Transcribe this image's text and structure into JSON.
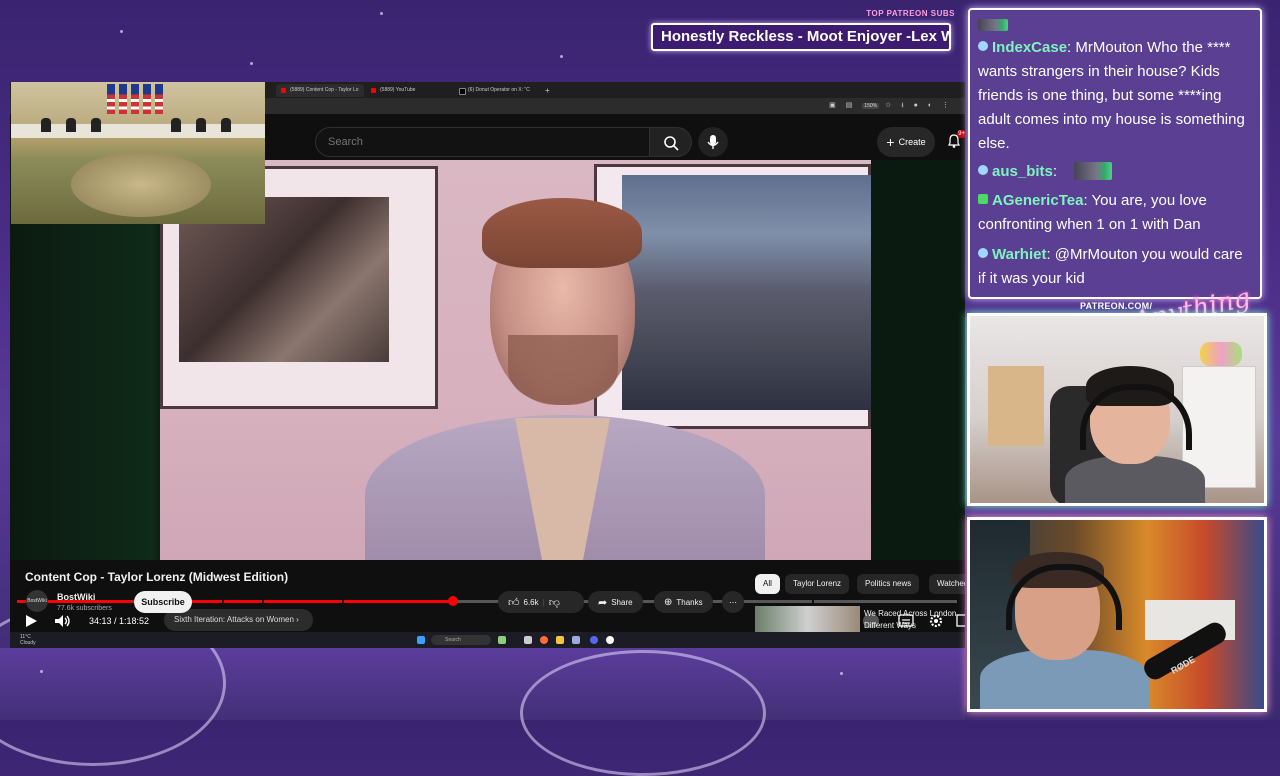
{
  "overlay": {
    "patreon_heading": "TOP PATREON SUBS",
    "patreon_ticker": "Honestly Reckless - Moot Enjoyer -Lex Wi",
    "patreon_url": "PATREON.COM/",
    "anything_else_logo": "AnythingElse"
  },
  "browser": {
    "tabs": [
      {
        "label": "(5889) Content Cop - Taylor Lo"
      },
      {
        "label": "(5889) YouTube"
      },
      {
        "label": "(6) Donut Operator on X: \"C"
      }
    ],
    "zoom": "150%"
  },
  "youtube": {
    "search_placeholder": "Search",
    "create_label": "Create",
    "notification_count": "9+",
    "player": {
      "current_time": "34:13",
      "duration": "1:18:52",
      "time_display": "34:13 / 1:18:52",
      "progress_fraction": 0.464,
      "chapter_label": "Sixth Iteration: Attacks on Women"
    },
    "video_title": "Content Cop - Taylor Lorenz (Midwest Edition)",
    "channel": {
      "name": "BostWiki",
      "subscribers": "77.6k subscribers",
      "avatar_text": "BostWiki"
    },
    "subscribe_label": "Subscribe",
    "like_count": "6.6k",
    "share_label": "Share",
    "thanks_label": "Thanks",
    "chips": [
      "All",
      "Taylor Lorenz",
      "Politics news",
      "Watched"
    ],
    "recommendation": {
      "title": "We Raced Across London Different Ways"
    }
  },
  "taskbar": {
    "weather_temp": "11°C",
    "weather_desc": "Cloudy",
    "search_label": "Search"
  },
  "chat": {
    "messages": [
      {
        "user": "IndexCase",
        "user_color": "#7ff3c0",
        "text": "MrMouton Who the **** wants strangers in their house? Kids friends is one thing, but some ****ing adult comes into my house is something else."
      },
      {
        "user": "aus_bits",
        "user_color": "#7ff3c0",
        "text": ""
      },
      {
        "user": "AGenericTea",
        "user_color": "#7ff3c0",
        "text": "You are, you love confronting when 1 on 1 with Dan"
      },
      {
        "user": "Warhiet",
        "user_color": "#7ff3c0",
        "text": "@MrMouton you would care if it was your kid"
      }
    ]
  },
  "colors": {
    "accent_red": "#ff0000",
    "chat_bg": "#5a3f92",
    "neon_pink": "#ff9ad5",
    "neon_teal": "#7ff3e1"
  }
}
